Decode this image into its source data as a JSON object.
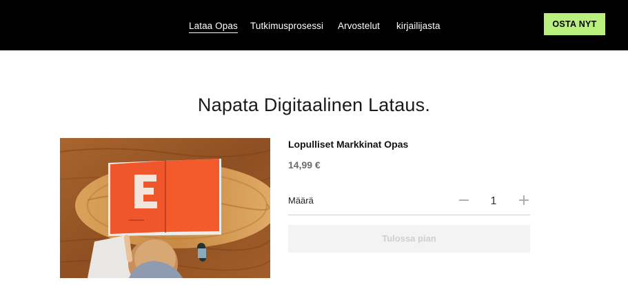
{
  "header": {
    "nav": [
      {
        "label": "Lataa Opas",
        "active": true
      },
      {
        "label": "Tutkimusprosessi",
        "active": false
      },
      {
        "label": "Arvostelut",
        "active": false
      },
      {
        "label": "kirjailijasta",
        "active": false
      }
    ],
    "buy_button": "OSTA NYT",
    "colors": {
      "background": "#000000",
      "buy_button": "#b8ef7d"
    }
  },
  "main": {
    "title": "Napata Digitaalinen Lataus.",
    "product": {
      "name": "Lopulliset Markkinat Opas",
      "price": "14,99 €",
      "quantity_label": "Määrä",
      "quantity": "1",
      "decrement_icon": "minus-icon",
      "increment_icon": "plus-icon",
      "cta_label": "Tulossa pian",
      "image": "photo of an open orange book with a large letter E on a wooden table, child reaching toward it",
      "image_letter": "E"
    }
  }
}
